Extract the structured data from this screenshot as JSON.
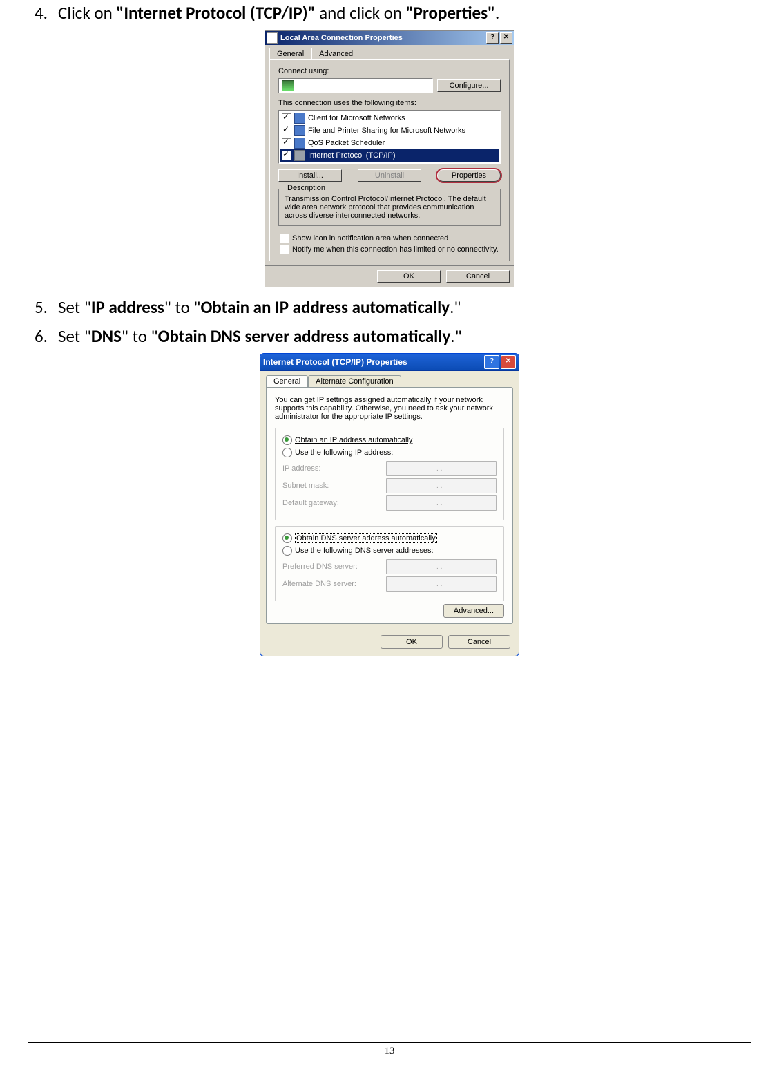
{
  "page_number": "13",
  "step4": {
    "num": "4.",
    "pre": "Click on ",
    "q1": "\"Internet Protocol (TCP/IP)\"",
    "mid": " and click on ",
    "q2": "\"Properties\"",
    "post": "."
  },
  "step5": {
    "num": "5.",
    "pre": "Set \"",
    "b1": "IP address",
    "mid": "\" to \"",
    "b2": "Obtain an IP address automatically",
    "post": ".\""
  },
  "step6": {
    "num": "6.",
    "pre": "Set \"",
    "b1": "DNS",
    "mid": "\" to \"",
    "b2": "Obtain DNS server address automatically",
    "post": ".\""
  },
  "dlg1": {
    "title": "Local Area Connection    Properties",
    "help": "?",
    "close": "✕",
    "tabs": {
      "general": "General",
      "advanced": "Advanced"
    },
    "connect_using": "Connect using:",
    "configure": "Configure...",
    "uses_items": "This connection uses the following items:",
    "items": [
      "Client for Microsoft Networks",
      "File and Printer Sharing for Microsoft Networks",
      "QoS Packet Scheduler",
      "Internet Protocol (TCP/IP)"
    ],
    "install": "Install...",
    "uninstall": "Uninstall",
    "properties": "Properties",
    "desc_legend": "Description",
    "desc_text": "Transmission Control Protocol/Internet Protocol. The default wide area network protocol that provides communication across diverse interconnected networks.",
    "show_icon": "Show icon in notification area when connected",
    "notify": "Notify me when this connection has limited or no connectivity.",
    "ok": "OK",
    "cancel": "Cancel"
  },
  "dlg2": {
    "title": "Internet Protocol (TCP/IP) Properties",
    "help": "?",
    "close": "✕",
    "tabs": {
      "general": "General",
      "alt": "Alternate Configuration"
    },
    "intro": "You can get IP settings assigned automatically if your network supports this capability. Otherwise, you need to ask your network administrator for the appropriate IP settings.",
    "r_obtain_ip": "Obtain an IP address automatically",
    "r_use_ip": "Use the following IP address:",
    "ip_address": "IP address:",
    "subnet": "Subnet mask:",
    "gateway": "Default gateway:",
    "r_obtain_dns": "Obtain DNS server address automatically",
    "r_use_dns": "Use the following DNS server addresses:",
    "pref_dns": "Preferred DNS server:",
    "alt_dns": "Alternate DNS server:",
    "advanced": "Advanced...",
    "ok": "OK",
    "cancel": "Cancel",
    "dots": ".       .       ."
  }
}
